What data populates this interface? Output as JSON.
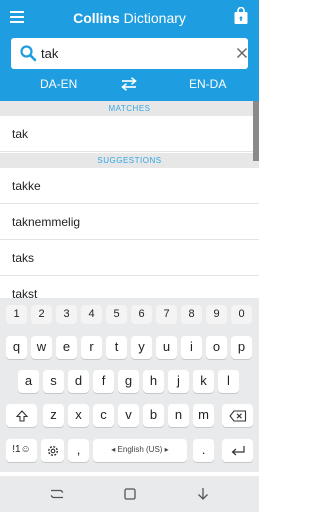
{
  "app": {
    "title_bold": "Collins",
    "title_rest": " Dictionary"
  },
  "search": {
    "value": "tak",
    "placeholder": ""
  },
  "lang": {
    "left": "DA-EN",
    "right": "EN-DA"
  },
  "sections": {
    "matches": "MATCHES",
    "suggestions": "SUGGESTIONS"
  },
  "matches": [
    "tak"
  ],
  "suggestions": [
    "takke",
    "taknemmelig",
    "taks",
    "takst"
  ],
  "keyboard": {
    "numbers": [
      "1",
      "2",
      "3",
      "4",
      "5",
      "6",
      "7",
      "8",
      "9",
      "0"
    ],
    "row1": [
      "q",
      "w",
      "e",
      "r",
      "t",
      "y",
      "u",
      "i",
      "o",
      "p"
    ],
    "row2": [
      "a",
      "s",
      "d",
      "f",
      "g",
      "h",
      "j",
      "k",
      "l"
    ],
    "row3": [
      "z",
      "x",
      "c",
      "v",
      "b",
      "n",
      "m"
    ],
    "symbols_key": "!1☺",
    "comma": ",",
    "space_label": "English (US)",
    "period": "."
  },
  "colors": {
    "accent": "#1e9de0",
    "section_text": "#33a6e2"
  },
  "icons": {
    "menu": "hamburger-icon",
    "store": "shopping-bag-icon",
    "search": "magnifier-icon",
    "clear": "close-icon",
    "swap": "swap-arrows-icon",
    "shift": "shift-arrow-icon",
    "backspace": "backspace-icon",
    "enter": "enter-arrow-icon",
    "settings": "gear-icon"
  }
}
